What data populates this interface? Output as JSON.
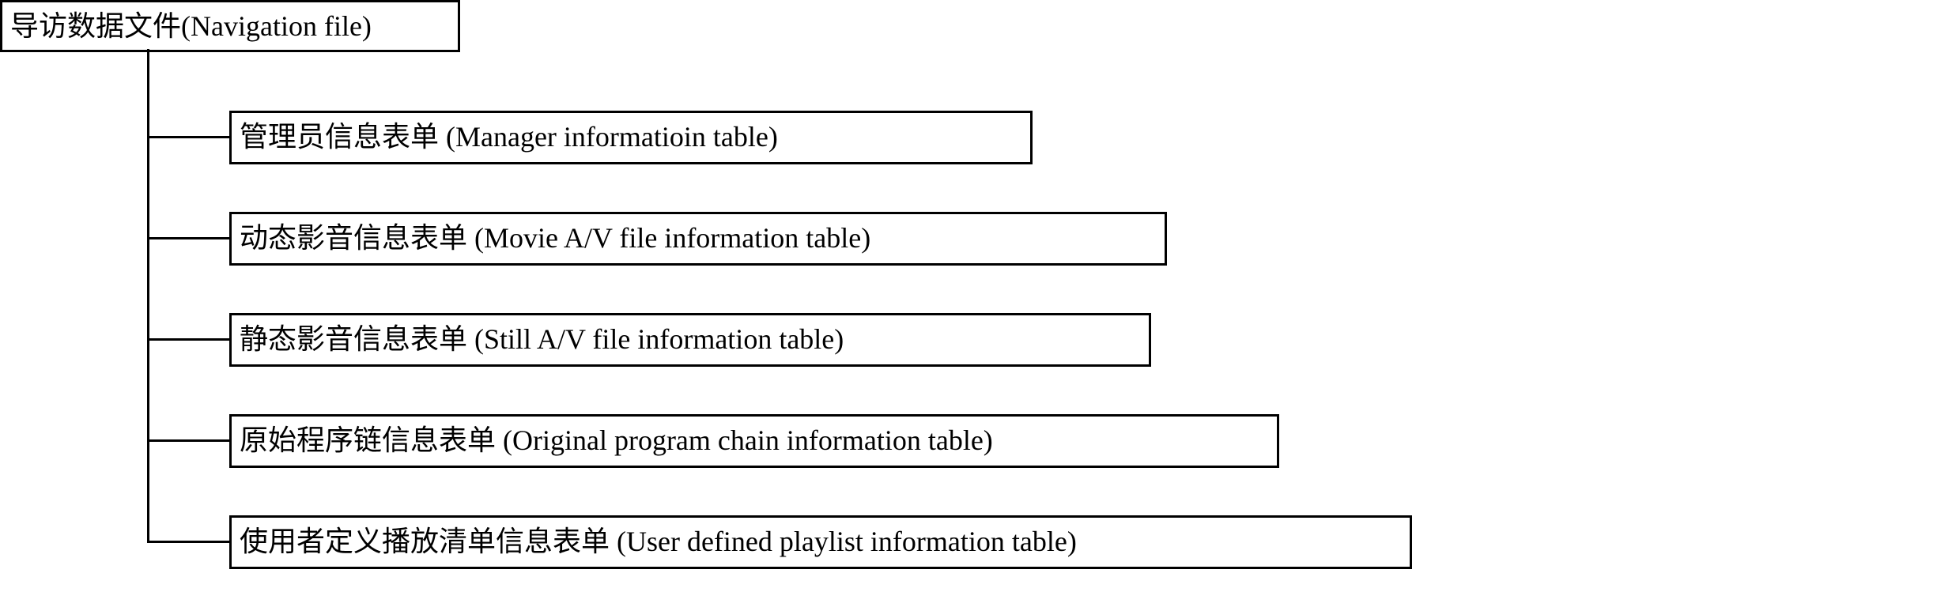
{
  "root": {
    "label": "导访数据文件(Navigation file)"
  },
  "children": [
    {
      "label": "管理员信息表单  (Manager informatioin table)"
    },
    {
      "label": "动态影音信息表单  (Movie A/V file information table)"
    },
    {
      "label": "静态影音信息表单 (Still A/V file information table)"
    },
    {
      "label": "原始程序链信息表单  (Original program chain information table)"
    },
    {
      "label": "使用者定义播放清单信息表单    (User defined playlist information table)"
    }
  ]
}
